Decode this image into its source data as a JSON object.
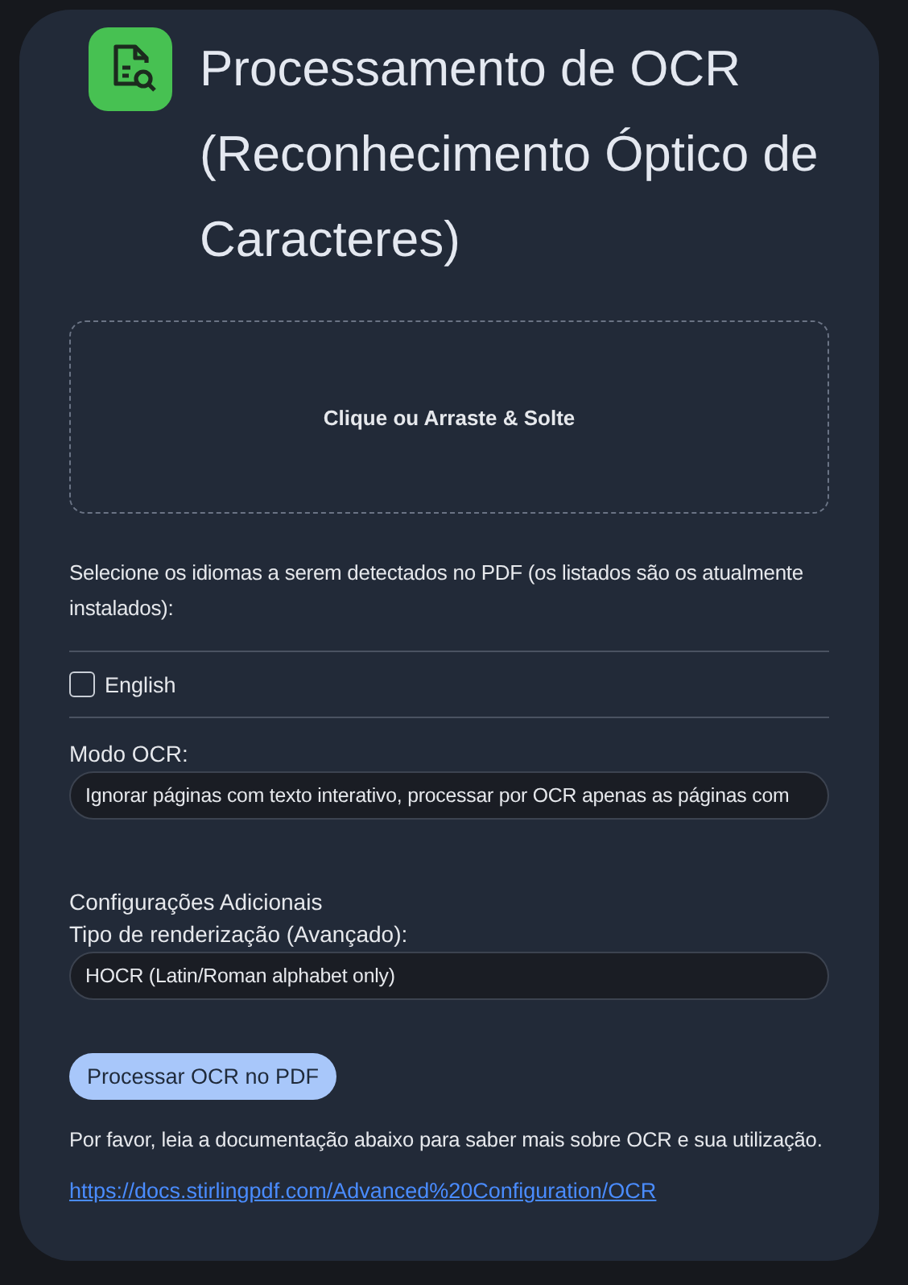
{
  "title": "Processamento de OCR (Reconhecimento Óptico de Caracteres)",
  "dropzone": {
    "label": "Clique ou Arraste & Solte"
  },
  "languages": {
    "label": "Selecione os idiomas a serem detectados no PDF (os listados são os atualmente instalados):",
    "options": [
      {
        "label": "English",
        "checked": false
      }
    ]
  },
  "ocr_mode": {
    "label": "Modo OCR:",
    "value": "Ignorar páginas com texto interativo, processar por OCR apenas as páginas com"
  },
  "additional": {
    "heading": "Configurações Adicionais",
    "render_label": "Tipo de renderização (Avançado):",
    "render_value": "HOCR (Latin/Roman alphabet only)"
  },
  "submit": "Processar OCR no PDF",
  "note": "Por favor, leia a documentação abaixo para saber mais sobre OCR e sua utilização.",
  "link": "https://docs.stirlingpdf.com/Advanced%20Configuration/OCR"
}
